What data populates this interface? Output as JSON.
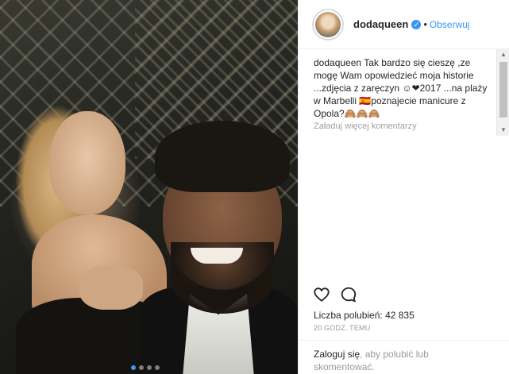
{
  "post": {
    "username": "dodaqueen",
    "separator": "•",
    "follow_label": "Obserwuj",
    "verified_glyph": "✓",
    "caption_username": "dodaqueen",
    "caption_text": "Tak bardzo się cieszę ,ze mogę Wam opowiedzieć moja historie ...zdjęcia z zaręczyn ☺❤2017 ...na plaży w Marbelli 🇪🇸poznajecie manicure z Opola?🙈🙈🙈",
    "load_more": "Załaduj więcej komentarzy",
    "likes_label": "Liczba polubień:",
    "likes_count": "42 835",
    "timestamp": "20 GODZ. TEMU",
    "login_link": "Zaloguj się",
    "login_text": ", aby polubić lub skomentować."
  },
  "carousel": {
    "count": 4,
    "active_index": 0
  },
  "colors": {
    "accent": "#3897f0",
    "text": "#262626",
    "muted": "#999999"
  },
  "icons": [
    "verified-badge-icon",
    "heart-icon",
    "comment-icon",
    "scroll-up-icon",
    "scroll-down-icon"
  ]
}
